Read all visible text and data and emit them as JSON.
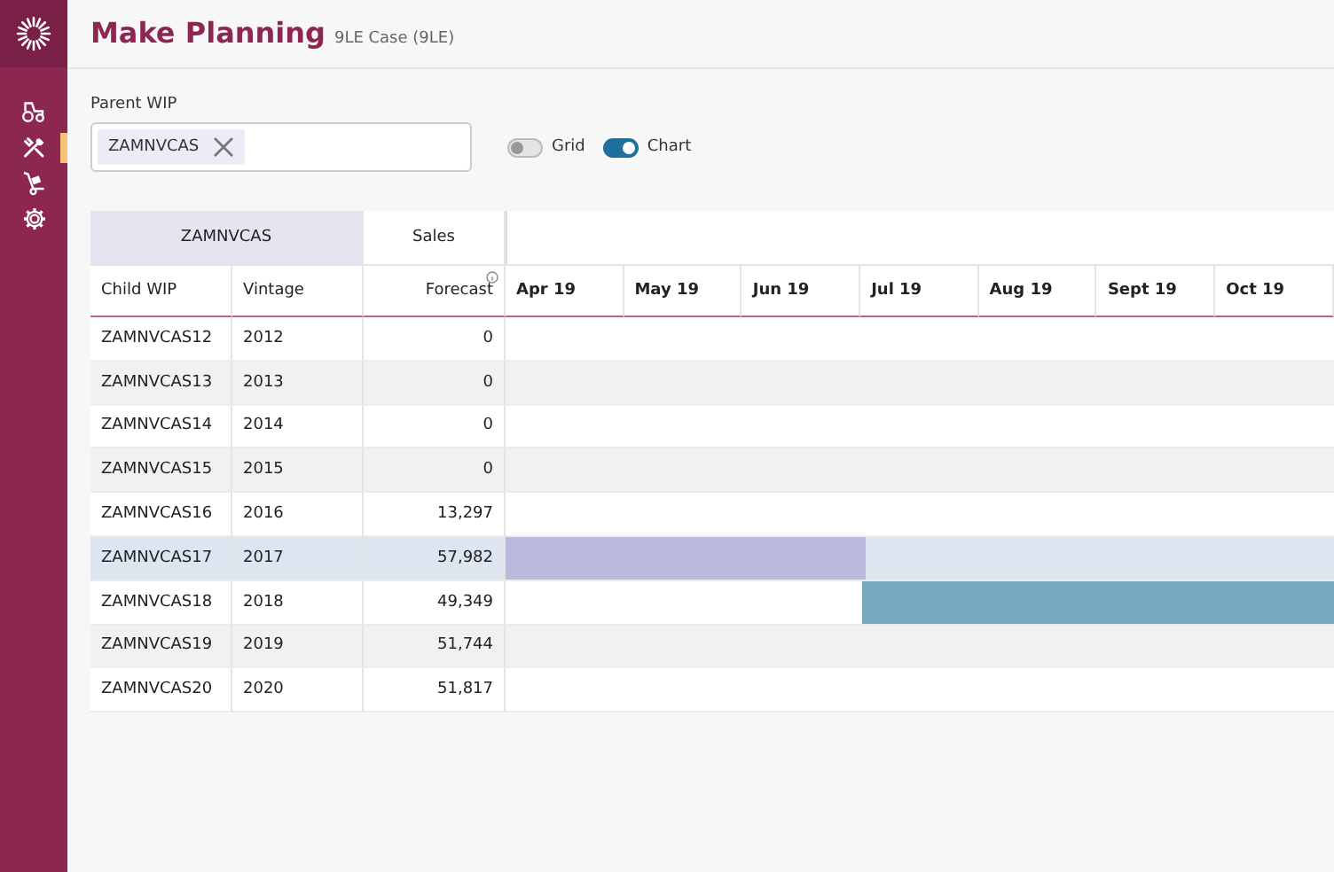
{
  "header": {
    "title": "Make Planning",
    "subtitle": "9LE Case (9LE)"
  },
  "sidebar": {
    "items": [
      {
        "kind": "tractor",
        "selected": false
      },
      {
        "kind": "tools",
        "selected": true
      },
      {
        "kind": "dolly",
        "selected": false
      },
      {
        "kind": "gear",
        "selected": false
      }
    ]
  },
  "parent_wip": {
    "label": "Parent WIP",
    "chips": [
      "ZAMNVCAS"
    ]
  },
  "view_toggles": [
    {
      "label": "Grid",
      "on": false
    },
    {
      "label": "Chart",
      "on": true
    }
  ],
  "table": {
    "groups": [
      {
        "label": "ZAMNVCAS",
        "selected": true
      },
      {
        "label": "Sales",
        "selected": false
      }
    ],
    "columns": [
      "Child WIP",
      "Vintage",
      "Forecast"
    ],
    "months": [
      "Apr 19",
      "May 19",
      "Jun 19",
      "Jul 19",
      "Aug 19",
      "Sept 19",
      "Oct 19"
    ],
    "rows": [
      {
        "child": "ZAMNVCAS12",
        "vintage": "2012",
        "forecast": "0",
        "selected": false
      },
      {
        "child": "ZAMNVCAS13",
        "vintage": "2013",
        "forecast": "0",
        "selected": false
      },
      {
        "child": "ZAMNVCAS14",
        "vintage": "2014",
        "forecast": "0",
        "selected": false
      },
      {
        "child": "ZAMNVCAS15",
        "vintage": "2015",
        "forecast": "0",
        "selected": false
      },
      {
        "child": "ZAMNVCAS16",
        "vintage": "2016",
        "forecast": "13,297",
        "selected": false
      },
      {
        "child": "ZAMNVCAS17",
        "vintage": "2017",
        "forecast": "57,982",
        "selected": true,
        "bar": {
          "kind": "from-start",
          "level": 0.435
        }
      },
      {
        "child": "ZAMNVCAS18",
        "vintage": "2018",
        "forecast": "49,349",
        "selected": false,
        "bar": {
          "kind": "to-end",
          "level": 0.57
        }
      },
      {
        "child": "ZAMNVCAS19",
        "vintage": "2019",
        "forecast": "51,744",
        "selected": false
      },
      {
        "child": "ZAMNVCAS20",
        "vintage": "2020",
        "forecast": "51,817",
        "selected": false
      }
    ]
  }
}
